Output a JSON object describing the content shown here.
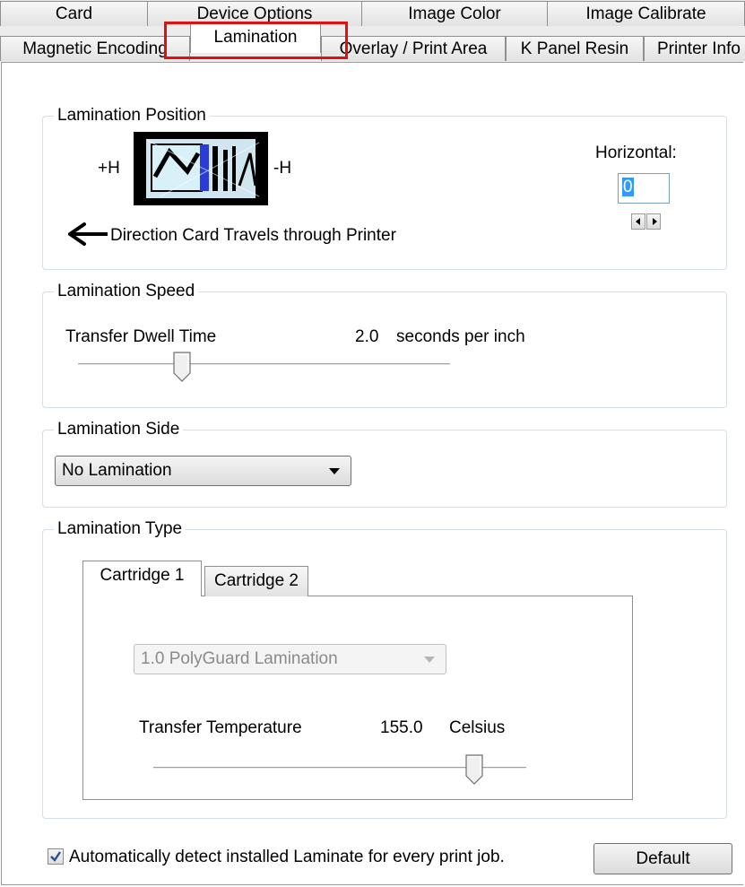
{
  "tabs_row1": [
    {
      "label": "Card"
    },
    {
      "label": "Device Options"
    },
    {
      "label": "Image Color"
    },
    {
      "label": "Image Calibrate"
    }
  ],
  "tabs_row2": [
    {
      "label": "Magnetic Encoding"
    },
    {
      "label": "Lamination",
      "active": true
    },
    {
      "label": "Overlay / Print Area"
    },
    {
      "label": "K Panel Resin"
    },
    {
      "label": "Printer Info"
    }
  ],
  "position": {
    "title": "Lamination Position",
    "plus_h": "+H",
    "minus_h": "-H",
    "direction": "Direction Card Travels through Printer",
    "horizontal_label": "Horizontal:",
    "horizontal_value": "0",
    "icons": [
      "card-preview-icon",
      "left-arrow-icon",
      "spin-left-icon",
      "spin-right-icon"
    ]
  },
  "speed": {
    "title": "Lamination Speed",
    "label": "Transfer Dwell Time",
    "value": "2.0",
    "unit": "seconds per inch",
    "slider_fraction": 0.28
  },
  "side": {
    "title": "Lamination Side",
    "selected": "No Lamination"
  },
  "type": {
    "title": "Lamination Type",
    "tabs": [
      {
        "label": "Cartridge 1",
        "active": true
      },
      {
        "label": "Cartridge 2"
      }
    ],
    "selected": "1.0 PolyGuard Lamination",
    "temp_label": "Transfer Temperature",
    "temp_value": "155.0",
    "temp_unit": "Celsius",
    "slider_fraction": 0.86
  },
  "footer": {
    "auto_detect_label": "Automatically detect installed Laminate for every print job.",
    "auto_detect_checked": true,
    "default_label": "Default"
  },
  "colors": {
    "highlight": "#e01010",
    "selection": "#3399ff"
  }
}
